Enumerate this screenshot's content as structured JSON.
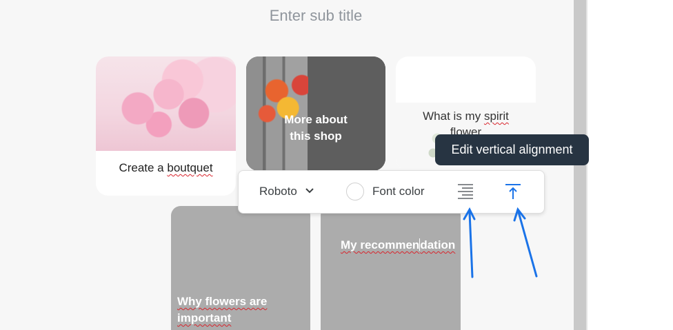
{
  "header": {
    "subtitle_placeholder": "Enter sub title"
  },
  "cards": [
    {
      "label": "Create a ",
      "label_misspelled": "boutquet"
    },
    {
      "title_line1": "More about",
      "title_line2": "this shop"
    },
    {
      "title_part1": "What is my ",
      "title_misspelled": "spirit",
      "title_line2": "flower"
    },
    {
      "title_line1": "Why flowers are",
      "title_line2": "important"
    },
    {
      "title_before_caret": "My recommen",
      "title_after_caret": "dation"
    }
  ],
  "toolbar": {
    "font_name": "Roboto",
    "font_color_label": "Font color",
    "font_color_value": "#ffffff",
    "icons": {
      "font_dropdown": "chevron-down-icon",
      "horizontal_align": "align-right-icon",
      "vertical_align": "align-top-icon"
    }
  },
  "tooltip": {
    "text": "Edit vertical alignment"
  },
  "colors": {
    "accent": "#1a73e8",
    "tooltip_bg": "#273442",
    "annotation_arrow": "#1a73e8",
    "spellcheck": "#d9232b"
  }
}
